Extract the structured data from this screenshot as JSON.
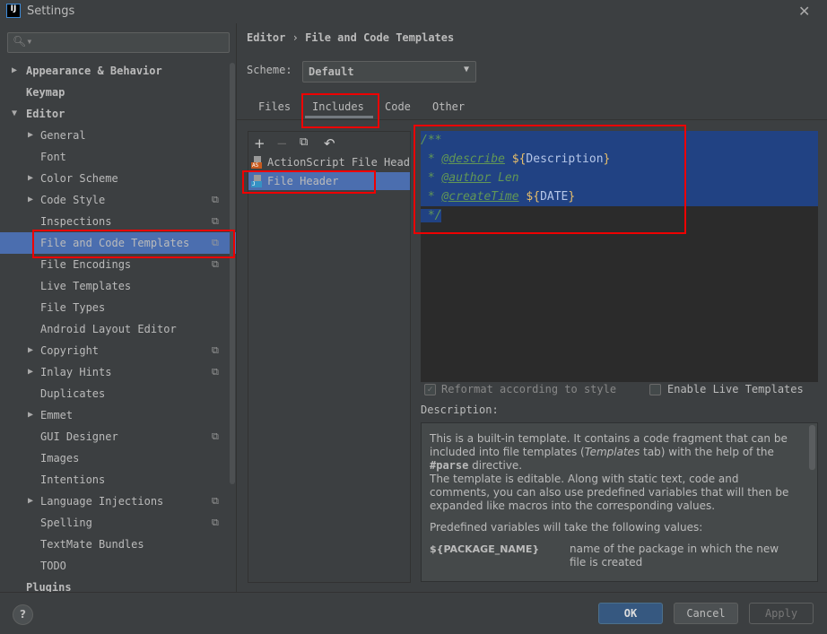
{
  "window": {
    "title": "Settings",
    "app_icon": "IJ"
  },
  "sidebar": {
    "search_placeholder": "",
    "items": [
      {
        "label": "Appearance & Behavior",
        "level": 0,
        "arrow": "right"
      },
      {
        "label": "Keymap",
        "level": 0
      },
      {
        "label": "Editor",
        "level": 0,
        "arrow": "down"
      },
      {
        "label": "General",
        "level": 1,
        "arrow": "right"
      },
      {
        "label": "Font",
        "level": 1
      },
      {
        "label": "Color Scheme",
        "level": 1,
        "arrow": "right"
      },
      {
        "label": "Code Style",
        "level": 1,
        "arrow": "right",
        "project": true
      },
      {
        "label": "Inspections",
        "level": 1,
        "project": true
      },
      {
        "label": "File and Code Templates",
        "level": 1,
        "project": true,
        "selected": true
      },
      {
        "label": "File Encodings",
        "level": 1,
        "project": true
      },
      {
        "label": "Live Templates",
        "level": 1
      },
      {
        "label": "File Types",
        "level": 1
      },
      {
        "label": "Android Layout Editor",
        "level": 1
      },
      {
        "label": "Copyright",
        "level": 1,
        "arrow": "right",
        "project": true
      },
      {
        "label": "Inlay Hints",
        "level": 1,
        "arrow": "right",
        "project": true
      },
      {
        "label": "Duplicates",
        "level": 1
      },
      {
        "label": "Emmet",
        "level": 1,
        "arrow": "right"
      },
      {
        "label": "GUI Designer",
        "level": 1,
        "project": true
      },
      {
        "label": "Images",
        "level": 1
      },
      {
        "label": "Intentions",
        "level": 1
      },
      {
        "label": "Language Injections",
        "level": 1,
        "arrow": "right",
        "project": true
      },
      {
        "label": "Spelling",
        "level": 1,
        "project": true
      },
      {
        "label": "TextMate Bundles",
        "level": 1
      },
      {
        "label": "TODO",
        "level": 1
      },
      {
        "label": "Plugins",
        "level": 0
      }
    ]
  },
  "breadcrumb": [
    "Editor",
    "File and Code Templates"
  ],
  "scheme": {
    "label": "Scheme:",
    "value": "Default"
  },
  "tabs": [
    "Files",
    "Includes",
    "Code",
    "Other"
  ],
  "active_tab": "Includes",
  "templates": [
    {
      "name": "ActionScript File Header",
      "badge": "AS",
      "badge_color": "#c75a1e"
    },
    {
      "name": "File Header",
      "badge": "J",
      "badge_color": "#3592c4",
      "selected": true
    }
  ],
  "editor": {
    "lines": [
      [
        {
          "t": "/**",
          "c": "cm"
        }
      ],
      [
        {
          "t": " * ",
          "c": "cm"
        },
        {
          "t": "@describe",
          "c": "tag"
        },
        {
          "t": " ",
          "c": "cm"
        },
        {
          "t": "$",
          "c": "dl"
        },
        {
          "t": "{",
          "c": "dl"
        },
        {
          "t": "Description",
          "c": "var"
        },
        {
          "t": "}",
          "c": "dl"
        }
      ],
      [
        {
          "t": " * ",
          "c": "cm"
        },
        {
          "t": "@author",
          "c": "tag"
        },
        {
          "t": " Len",
          "c": "cm"
        }
      ],
      [
        {
          "t": " * ",
          "c": "cm"
        },
        {
          "t": "@createTime",
          "c": "tag"
        },
        {
          "t": " ",
          "c": "cm"
        },
        {
          "t": "$",
          "c": "dl"
        },
        {
          "t": "{",
          "c": "dl"
        },
        {
          "t": "DATE",
          "c": "var"
        },
        {
          "t": "}",
          "c": "dl"
        }
      ],
      [
        {
          "t": " */",
          "c": "cm"
        }
      ]
    ]
  },
  "options": {
    "reformat": {
      "label": "Reformat according to style",
      "checked": true,
      "disabled": true
    },
    "live": {
      "label": "Enable Live Templates",
      "checked": false
    }
  },
  "description": {
    "label": "Description:",
    "p1_a": "This is a built-in template. It contains a code fragment that can be included into file templates (",
    "p1_em": "Templates",
    "p1_b": " tab) with the help of the ",
    "p1_code": "#parse",
    "p1_c": " directive.",
    "p2": "The template is editable. Along with static text, code and comments, you can also use predefined variables that will then be expanded like macros into the corresponding values.",
    "p3": "Predefined variables will take the following values:",
    "var_name": "${PACKAGE_NAME}",
    "var_desc": "name of the package in which the new file is created"
  },
  "buttons": {
    "help": "?",
    "ok": "OK",
    "cancel": "Cancel",
    "apply": "Apply"
  },
  "colors": {
    "selection": "#4b6eaf",
    "editor_bg": "#2b2b2b",
    "highlight": "#214283",
    "annotation": "#e00000"
  }
}
